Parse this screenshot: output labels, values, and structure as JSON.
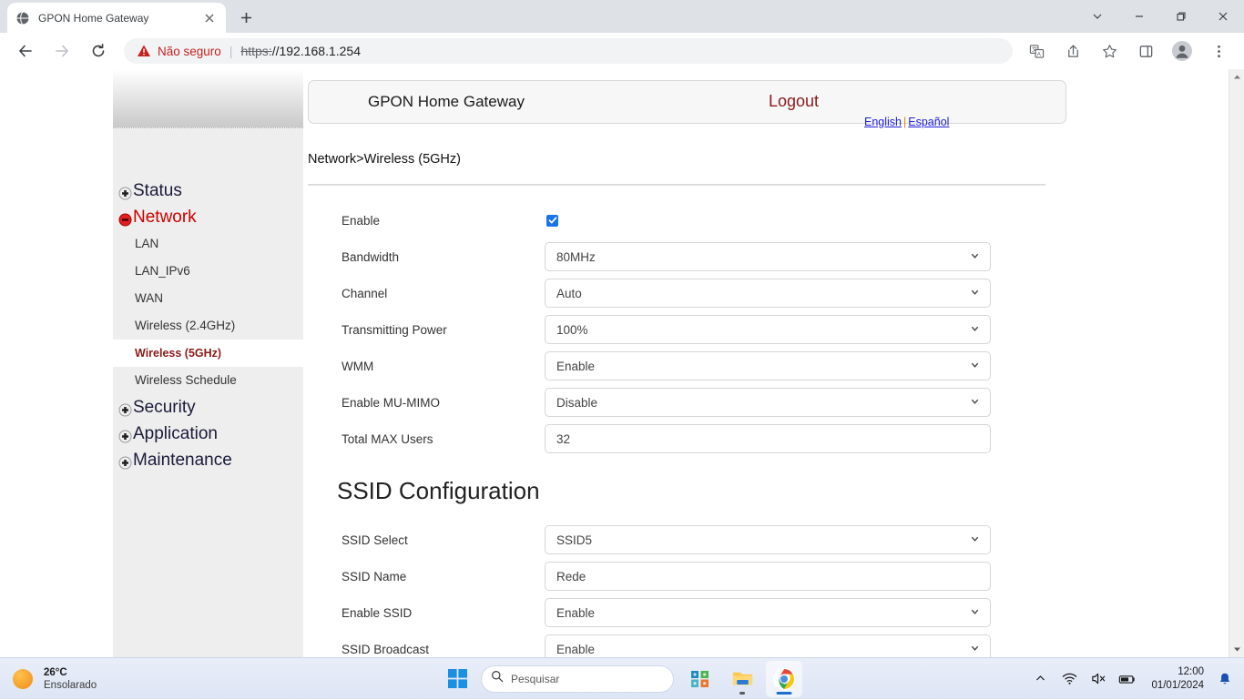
{
  "browser": {
    "tab": {
      "title": "GPON Home Gateway",
      "favicon_icon": "globe-icon",
      "close_icon": "close-icon"
    },
    "new_tab_icon": "plus-icon",
    "window_controls": {
      "tab_search_icon": "chevron-down-icon",
      "minimize_icon": "minimize-icon",
      "maximize_icon": "restore-icon",
      "close_icon": "close-icon"
    },
    "toolbar": {
      "back_icon": "back-arrow-icon",
      "forward_icon": "forward-arrow-icon",
      "reload_icon": "reload-icon",
      "warning_icon": "warning-triangle-icon",
      "security_text": "Não seguro",
      "separator": "|",
      "url_scheme": "https:",
      "url_rest": "//192.168.1.254",
      "translate_icon": "translate-icon",
      "share_icon": "share-icon",
      "bookmark_icon": "star-icon",
      "sidepanel_icon": "side-panel-icon",
      "profile_icon": "profile-avatar-icon",
      "menu_icon": "three-dot-menu-icon"
    },
    "scrollbar": {
      "up_icon": "scroll-up-arrow-icon",
      "down_icon": "scroll-down-arrow-icon"
    }
  },
  "router": {
    "header": {
      "title": "GPON Home Gateway",
      "logout": "Logout",
      "lang_english": "English",
      "lang_separator": "|",
      "lang_spanish": "Español"
    },
    "breadcrumb": "Network>Wireless (5GHz)",
    "sidebar": {
      "items": [
        {
          "label": "Status",
          "type": "top",
          "state": "collapsed",
          "icon": "plus-box-icon"
        },
        {
          "label": "Network",
          "type": "top",
          "state": "expanded",
          "icon": "minus-box-icon"
        },
        {
          "label": "LAN",
          "type": "sub",
          "active": false
        },
        {
          "label": "LAN_IPv6",
          "type": "sub",
          "active": false
        },
        {
          "label": "WAN",
          "type": "sub",
          "active": false
        },
        {
          "label": "Wireless (2.4GHz)",
          "type": "sub",
          "active": false
        },
        {
          "label": "Wireless (5GHz)",
          "type": "sub",
          "active": true
        },
        {
          "label": "Wireless Schedule",
          "type": "sub",
          "active": false
        },
        {
          "label": "Security",
          "type": "top",
          "state": "collapsed",
          "icon": "plus-box-icon"
        },
        {
          "label": "Application",
          "type": "top",
          "state": "collapsed",
          "icon": "plus-box-icon"
        },
        {
          "label": "Maintenance",
          "type": "top",
          "state": "collapsed",
          "icon": "plus-box-icon"
        }
      ]
    },
    "wireless_form": {
      "fields": [
        {
          "label": "Enable",
          "control": "checkbox",
          "checked": true
        },
        {
          "label": "Bandwidth",
          "control": "select",
          "value": "80MHz"
        },
        {
          "label": "Channel",
          "control": "select",
          "value": "Auto"
        },
        {
          "label": "Transmitting Power",
          "control": "select",
          "value": "100%"
        },
        {
          "label": "WMM",
          "control": "select",
          "value": "Enable"
        },
        {
          "label": "Enable MU-MIMO",
          "control": "select",
          "value": "Disable"
        },
        {
          "label": "Total MAX Users",
          "control": "text",
          "value": "32"
        }
      ]
    },
    "ssid_section": {
      "title": "SSID Configuration",
      "fields": [
        {
          "label": "SSID Select",
          "control": "select",
          "value": "SSID5"
        },
        {
          "label": "SSID Name",
          "control": "text",
          "value": "Rede"
        },
        {
          "label": "Enable SSID",
          "control": "select",
          "value": "Enable"
        },
        {
          "label": "SSID Broadcast",
          "control": "select",
          "value": "Enable"
        },
        {
          "label": "",
          "control": "select",
          "value": "",
          "disabled": true
        }
      ]
    }
  },
  "taskbar": {
    "weather": {
      "temperature": "26°C",
      "condition": "Ensolarado",
      "icon": "sun-icon"
    },
    "start_icon": "windows-start-icon",
    "search": {
      "placeholder": "Pesquisar",
      "icon": "search-icon"
    },
    "apps": [
      {
        "name": "widgets-icon",
        "running": false
      },
      {
        "name": "file-explorer-icon",
        "running": true
      },
      {
        "name": "chrome-icon",
        "running": true,
        "active": true
      }
    ],
    "tray": {
      "overflow_icon": "chevron-up-icon",
      "wifi_icon": "wifi-icon",
      "volume_icon": "volume-muted-icon",
      "battery_icon": "battery-icon",
      "time": "12:00",
      "date": "01/01/2024",
      "notification_icon": "bell-icon"
    }
  },
  "colors": {
    "accent_blue": "#1a73e8",
    "router_red": "#8b1a1a",
    "link_blue": "#2222dd",
    "warning_red": "#c5221f"
  }
}
